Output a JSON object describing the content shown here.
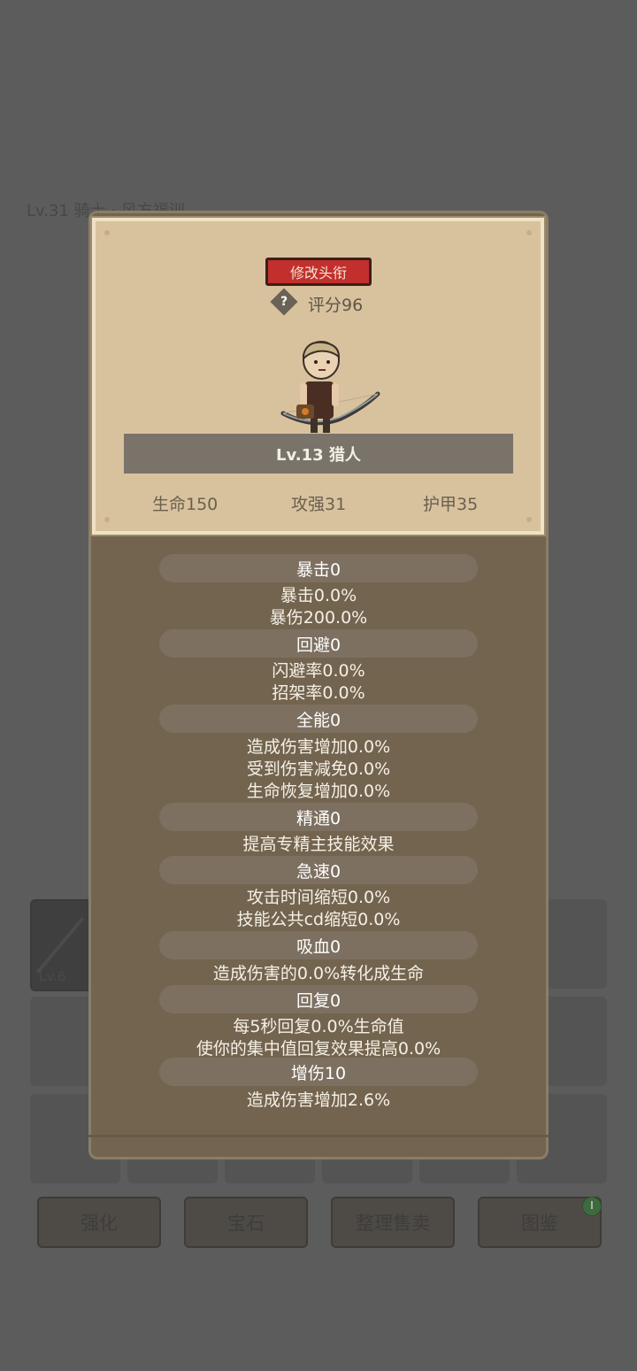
{
  "background": {
    "header_text": "Lv.31 骑士 · 风方福训",
    "slot_level": "Lv.6",
    "buttons": [
      "强化",
      "宝石",
      "整理售卖",
      "图鉴"
    ]
  },
  "card": {
    "rename_label": "修改头衔",
    "help_symbol": "?",
    "score": "评分96",
    "name": "Lv.13 猎人",
    "hp": "生命150",
    "attack": "攻强31",
    "armor": "护甲35"
  },
  "attributes": [
    {
      "title": "暴击0",
      "lines": [
        "暴击0.0%",
        "暴伤200.0%"
      ]
    },
    {
      "title": "回避0",
      "lines": [
        "闪避率0.0%",
        "招架率0.0%"
      ]
    },
    {
      "title": "全能0",
      "lines": [
        "造成伤害增加0.0%",
        "受到伤害减免0.0%",
        "生命恢复增加0.0%"
      ]
    },
    {
      "title": "精通0",
      "lines": [
        "提高专精主技能效果"
      ]
    },
    {
      "title": "急速0",
      "lines": [
        "攻击时间缩短0.0%",
        "技能公共cd缩短0.0%"
      ]
    },
    {
      "title": "吸血0",
      "lines": [
        "造成伤害的0.0%转化成生命"
      ]
    },
    {
      "title": "回复0",
      "lines": [
        "每5秒回复0.0%生命值",
        "使你的集中值回复效果提高0.0%"
      ]
    },
    {
      "title": "增伤10",
      "lines": [
        "造成伤害增加2.6%"
      ]
    }
  ],
  "colors": {
    "rename_button": "#c2302e",
    "panel": "#73644f",
    "card": "#d8c29e"
  }
}
